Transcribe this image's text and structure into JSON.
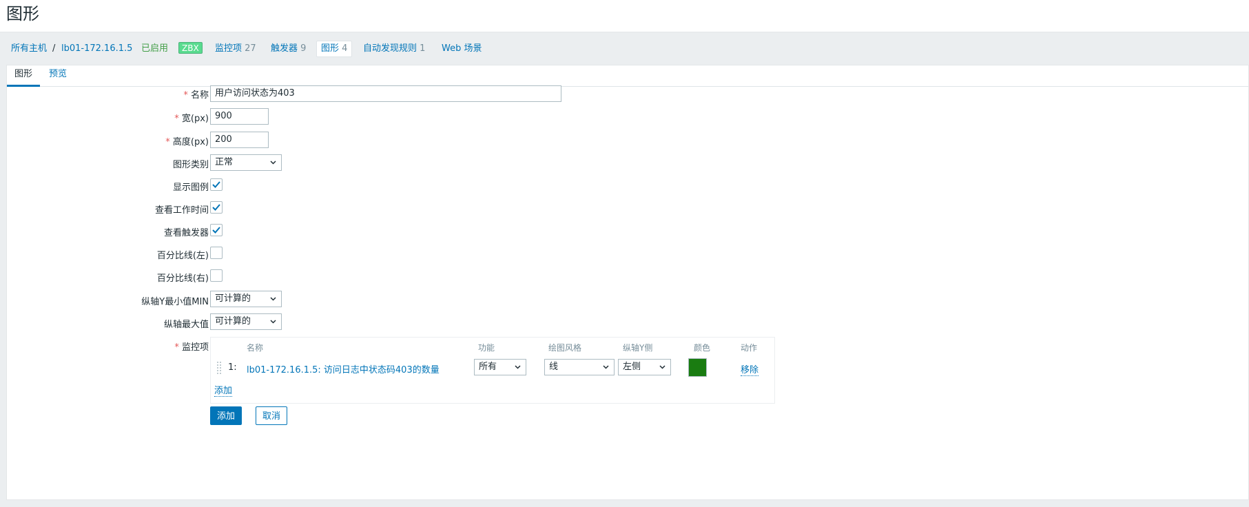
{
  "page": {
    "title": "图形"
  },
  "breadcrumb": {
    "all_hosts": "所有主机",
    "separator": "/",
    "host": "lb01-172.16.1.5",
    "status": "已启用",
    "zbx_badge": "ZBX",
    "items_label": "监控项",
    "items_count": "27",
    "triggers_label": "触发器",
    "triggers_count": "9",
    "graphs_label": "图形",
    "graphs_count": "4",
    "discovery_label": "自动发现规则",
    "discovery_count": "1",
    "web_label": "Web 场景"
  },
  "tabs": [
    {
      "label": "图形",
      "active": true
    },
    {
      "label": "预览",
      "active": false
    }
  ],
  "form": {
    "required_mark": "*",
    "name": {
      "label": "名称",
      "value": "用户访问状态为403"
    },
    "width": {
      "label": "宽(px)",
      "value": "900"
    },
    "height": {
      "label": "高度(px)",
      "value": "200"
    },
    "graph_type": {
      "label": "图形类别",
      "value": "正常"
    },
    "show_legend": {
      "label": "显示图例",
      "checked": true
    },
    "show_work_period": {
      "label": "查看工作时间",
      "checked": true
    },
    "show_triggers": {
      "label": "查看触发器",
      "checked": true
    },
    "percentile_left": {
      "label": "百分比线(左)",
      "checked": false
    },
    "percentile_right": {
      "label": "百分比线(右)",
      "checked": false
    },
    "y_min": {
      "label": "纵轴Y最小值MIN",
      "value": "可计算的"
    },
    "y_max": {
      "label": "纵轴最大值",
      "value": "可计算的"
    },
    "items_label": "监控项",
    "items_table": {
      "headers": {
        "name": "名称",
        "function": "功能",
        "draw_style": "绘图风格",
        "y_axis_side": "纵轴Y侧",
        "color": "颜色",
        "action": "动作"
      },
      "rows": [
        {
          "index": "1:",
          "name": "lb01-172.16.1.5: 访问日志中状态码403的数量",
          "function": "所有",
          "draw_style": "线",
          "y_axis_side": "左侧",
          "color": "#1A7C11",
          "action": "移除"
        }
      ],
      "add_link": "添加"
    }
  },
  "buttons": {
    "add": "添加",
    "cancel": "取消"
  },
  "colors": {
    "accent": "#0275b8",
    "enabled": "#429e47",
    "required": "#e45959",
    "zbx_badge": "#59db8f"
  }
}
